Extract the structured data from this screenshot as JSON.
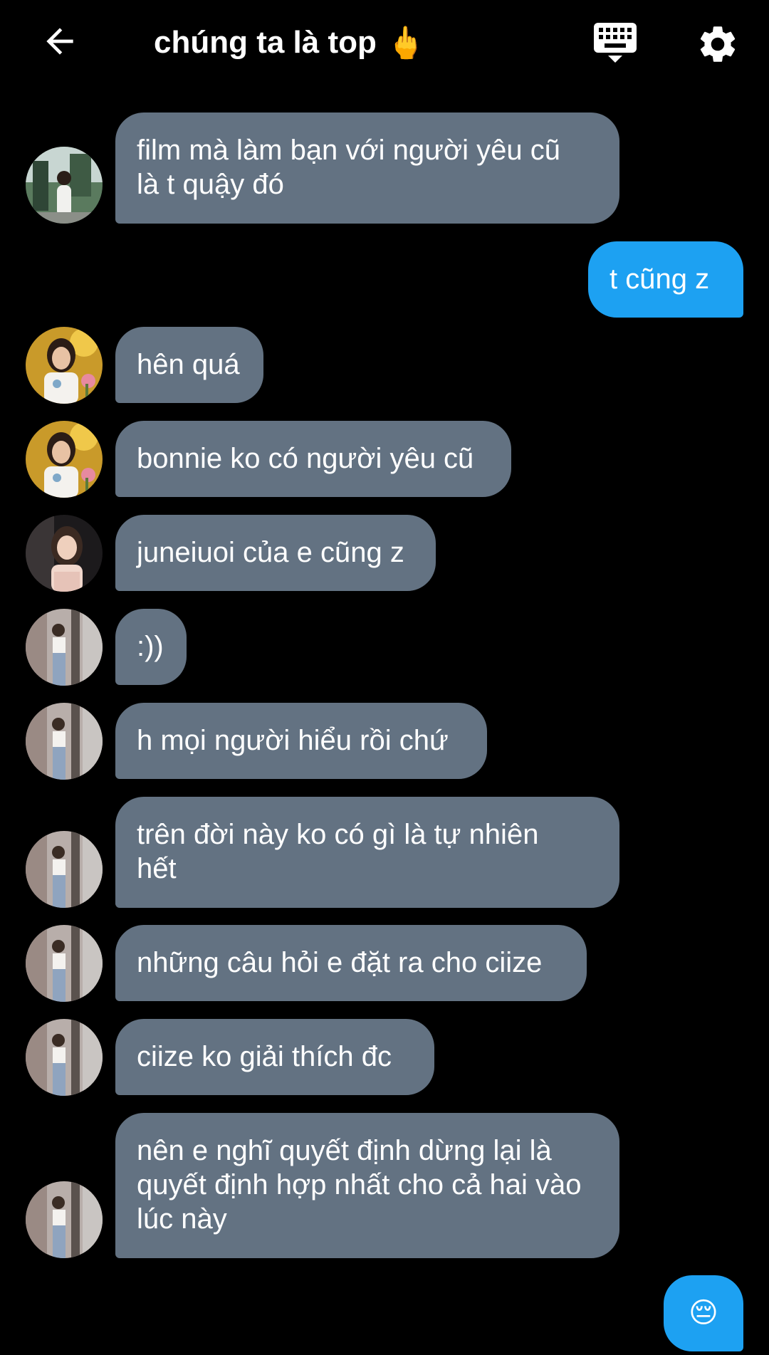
{
  "header": {
    "title": "chúng ta là top",
    "title_emoji": "🖕",
    "back_icon": "arrow-left-icon",
    "keyboard_icon": "keyboard-icon",
    "settings_icon": "gear-icon"
  },
  "colors": {
    "background": "#000000",
    "incoming_bubble": "#637282",
    "outgoing_bubble": "#1da1f2",
    "text": "#ffffff"
  },
  "messages": [
    {
      "side": "incoming",
      "text": "film mà làm bạn với người yêu cũ\nlà t quậy đó"
    },
    {
      "side": "outgoing",
      "text": "t cũng z"
    },
    {
      "side": "incoming",
      "text": "hên quá"
    },
    {
      "side": "incoming",
      "text": "bonnie ko có người yêu cũ"
    },
    {
      "side": "incoming",
      "text": "juneiuoi của e cũng z"
    },
    {
      "side": "incoming",
      "text": ":))"
    },
    {
      "side": "incoming",
      "text": "h mọi người hiểu rồi chứ"
    },
    {
      "side": "incoming",
      "text": "trên đời này ko có gì là tự nhiên\nhết"
    },
    {
      "side": "incoming",
      "text": "những câu hỏi e đặt ra cho ciize"
    },
    {
      "side": "incoming",
      "text": "ciize ko giải thích đc"
    },
    {
      "side": "incoming",
      "text": "nên e nghĩ quyết định dừng lại là\nquyết định hợp nhất cho cả hai vào\nlúc này"
    },
    {
      "side": "outgoing",
      "text": "😔"
    }
  ]
}
